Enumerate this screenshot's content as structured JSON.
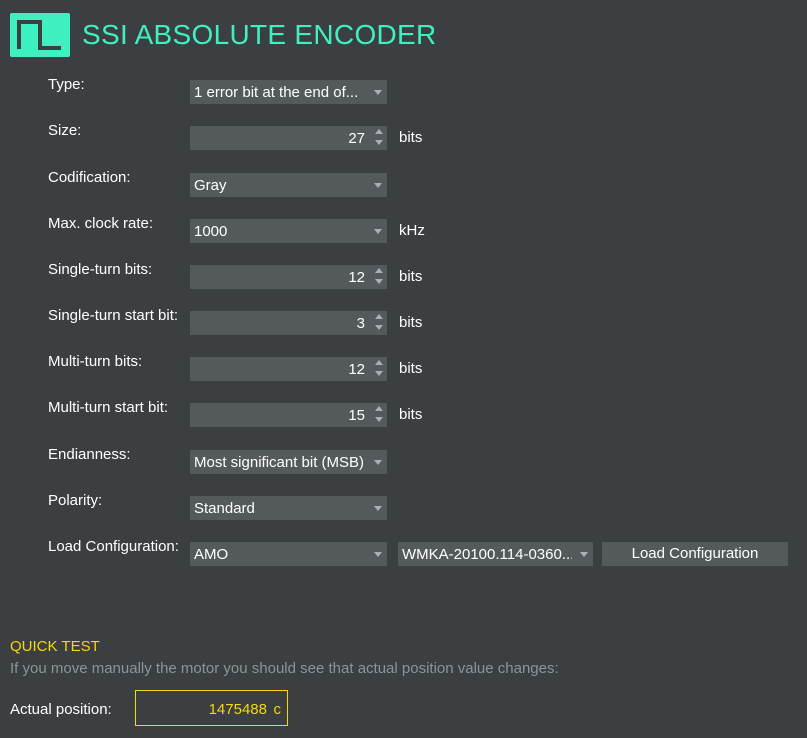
{
  "header": {
    "title": "SSI ABSOLUTE ENCODER",
    "accent_color": "#3ef0c0",
    "logo_icon": "square-wave-icon"
  },
  "form": {
    "type": {
      "label": "Type:",
      "value": "1 error bit at the end of..."
    },
    "size": {
      "label": "Size:",
      "value": "27",
      "unit": "bits"
    },
    "codification": {
      "label": "Codification:",
      "value": "Gray"
    },
    "max_clock_rate": {
      "label": "Max. clock rate:",
      "value": "1000",
      "unit": "kHz"
    },
    "single_turn_bits": {
      "label": "Single-turn bits:",
      "value": "12",
      "unit": "bits"
    },
    "single_turn_start_bit": {
      "label": "Single-turn start bit:",
      "value": "3",
      "unit": "bits"
    },
    "multi_turn_bits": {
      "label": "Multi-turn bits:",
      "value": "12",
      "unit": "bits"
    },
    "multi_turn_start_bit": {
      "label": "Multi-turn start bit:",
      "value": "15",
      "unit": "bits"
    },
    "endianness": {
      "label": "Endianness:",
      "value": "Most significant bit (MSB)"
    },
    "polarity": {
      "label": "Polarity:",
      "value": "Standard"
    },
    "load_configuration": {
      "label": "Load Configuration:",
      "manufacturer": "AMO",
      "model": "WMKA-20100.114-0360...",
      "button_label": "Load Configuration"
    }
  },
  "quick_test": {
    "title": "QUICK TEST",
    "description": "If you move manually the motor you should see that actual position value changes:",
    "position_label": "Actual position:",
    "position_value": "1475488",
    "position_unit": "c",
    "highlight_color": "#f5d90a"
  }
}
